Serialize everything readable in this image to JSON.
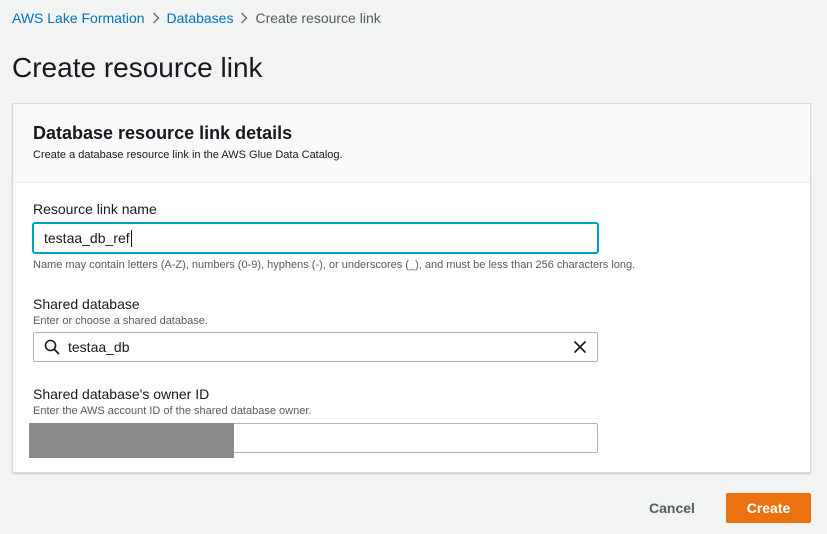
{
  "breadcrumb": {
    "items": [
      {
        "label": "AWS Lake Formation"
      },
      {
        "label": "Databases"
      },
      {
        "label": "Create resource link"
      }
    ]
  },
  "page": {
    "title": "Create resource link"
  },
  "panel": {
    "title": "Database resource link details",
    "description": "Create a database resource link in the AWS Glue Data Catalog."
  },
  "fields": {
    "resource_link_name": {
      "label": "Resource link name",
      "value": "testaa_db_ref",
      "constraint": "Name may contain letters (A-Z), numbers (0-9), hyphens (-), or underscores (_), and must be less than 256 characters long."
    },
    "shared_database": {
      "label": "Shared database",
      "description": "Enter or choose a shared database.",
      "value": "testaa_db"
    },
    "owner_id": {
      "label": "Shared database's owner ID",
      "description": "Enter the AWS account ID of the shared database owner.",
      "value": ""
    }
  },
  "footer": {
    "cancel_label": "Cancel",
    "create_label": "Create"
  },
  "colors": {
    "link": "#0073bb",
    "primary": "#ec7211",
    "focus": "#00a1c9"
  },
  "icons": {
    "breadcrumb_separator": "chevron-right-icon",
    "search": "search-icon",
    "clear": "close-icon"
  }
}
